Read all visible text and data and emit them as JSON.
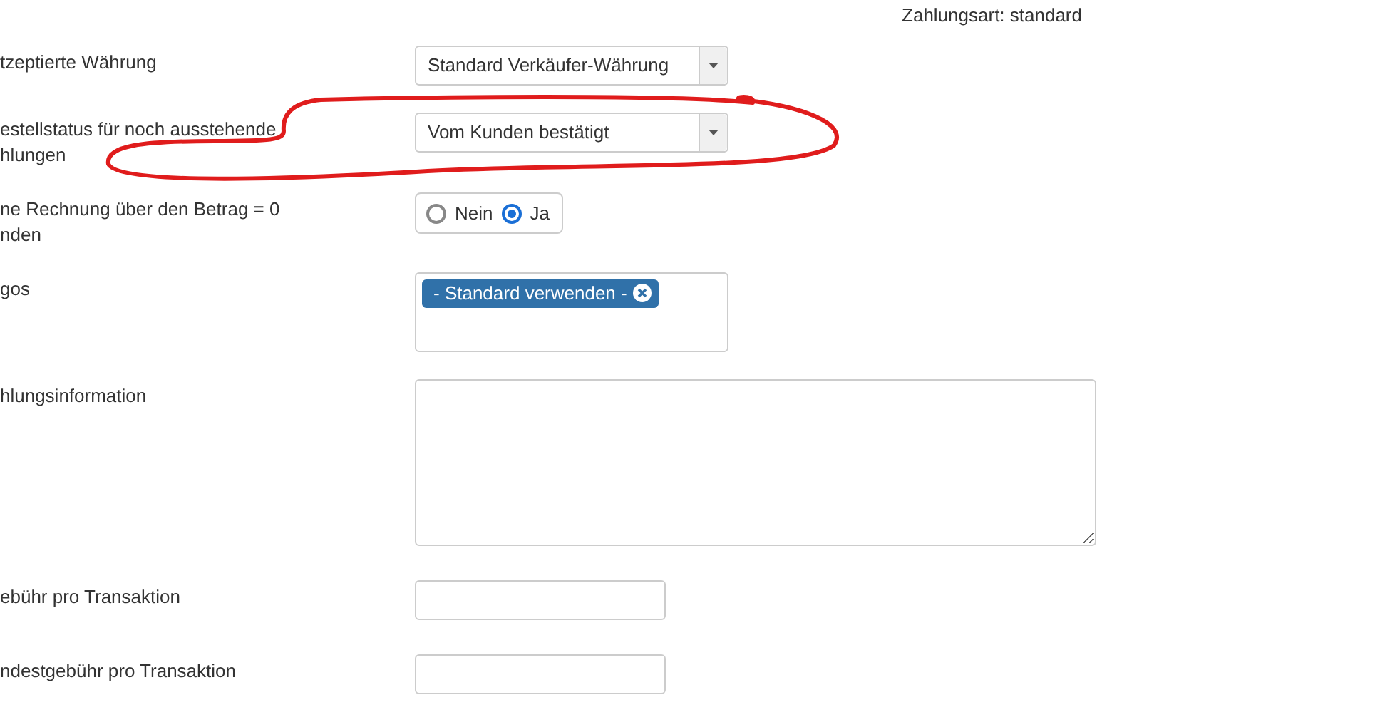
{
  "payment_type": "Zahlungsart: standard",
  "fields": [
    {
      "kind": "select",
      "label": "tzeptierte Währung",
      "value": "Standard Verkäufer-Währung"
    },
    {
      "kind": "select",
      "label": "estellstatus für noch ausstehende\nhlungen",
      "value": "Vom Kunden bestätigt"
    },
    {
      "kind": "radio",
      "label": "ne Rechnung über den Betrag = 0\nnden",
      "options": [
        {
          "label": "Nein",
          "selected": false
        },
        {
          "label": "Ja",
          "selected": true
        }
      ]
    },
    {
      "kind": "tags",
      "label": "gos",
      "tags": [
        "- Standard verwenden -"
      ]
    },
    {
      "kind": "textarea",
      "label": "hlungsinformation"
    },
    {
      "kind": "input",
      "label": "ebühr pro Transaktion"
    },
    {
      "kind": "input",
      "label": "ndestgebühr pro Transaktion"
    }
  ]
}
